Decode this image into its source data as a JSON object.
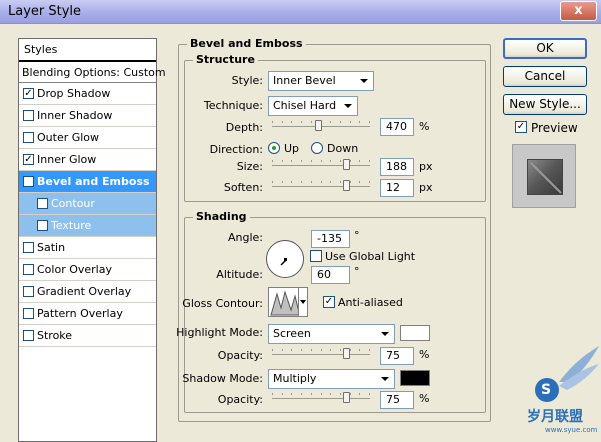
{
  "window": {
    "title": "Layer Style",
    "close_glyph": "x"
  },
  "styles_panel": {
    "header": "Styles",
    "blending": "Blending Options: Custom",
    "items": [
      {
        "label": "Drop Shadow",
        "checked": true
      },
      {
        "label": "Inner Shadow",
        "checked": false
      },
      {
        "label": "Outer Glow",
        "checked": false
      },
      {
        "label": "Inner Glow",
        "checked": true
      },
      {
        "label": "Bevel and Emboss",
        "checked": true
      },
      {
        "label": "Contour",
        "checked": true
      },
      {
        "label": "Texture",
        "checked": false
      },
      {
        "label": "Satin",
        "checked": false
      },
      {
        "label": "Color Overlay",
        "checked": false
      },
      {
        "label": "Gradient Overlay",
        "checked": false
      },
      {
        "label": "Pattern Overlay",
        "checked": false
      },
      {
        "label": "Stroke",
        "checked": false
      }
    ]
  },
  "bevel": {
    "title": "Bevel and Emboss",
    "structure": {
      "title": "Structure",
      "style_label": "Style:",
      "style_value": "Inner Bevel",
      "technique_label": "Technique:",
      "technique_value": "Chisel Hard",
      "depth_label": "Depth:",
      "depth_value": "470",
      "depth_unit": "%",
      "depth_slider_fraction": 0.47,
      "direction_label": "Direction:",
      "direction_up": "Up",
      "direction_down": "Down",
      "direction_selected": "Up",
      "size_label": "Size:",
      "size_value": "188",
      "size_unit": "px",
      "size_slider_fraction": 0.76,
      "soften_label": "Soften:",
      "soften_value": "12",
      "soften_unit": "px",
      "soften_slider_fraction": 0.76
    },
    "shading": {
      "title": "Shading",
      "angle_label": "Angle:",
      "angle_value": "-135",
      "angle_unit": "°",
      "global_light_label": "Use Global Light",
      "global_light_checked": false,
      "altitude_label": "Altitude:",
      "altitude_value": "60",
      "altitude_unit": "°",
      "gloss_label": "Gloss Contour:",
      "anti_aliased_label": "Anti-aliased",
      "anti_aliased_checked": true,
      "highlight_label": "Highlight Mode:",
      "highlight_value": "Screen",
      "highlight_color": "#ffffff",
      "highlight_opacity_label": "Opacity:",
      "highlight_opacity": "75",
      "highlight_opacity_unit": "%",
      "shadow_label": "Shadow Mode:",
      "shadow_value": "Multiply",
      "shadow_color": "#000000",
      "shadow_opacity_label": "Opacity:",
      "shadow_opacity": "75",
      "shadow_opacity_unit": "%"
    }
  },
  "buttons": {
    "ok": "OK",
    "cancel": "Cancel",
    "new_style": "New Style...",
    "preview_label": "Preview",
    "preview_checked": true
  },
  "watermark": {
    "text": "岁月联盟",
    "badge": "S",
    "url": "www.syue.com"
  },
  "icons": {
    "check": "✓",
    "gear": "gear-icon"
  }
}
